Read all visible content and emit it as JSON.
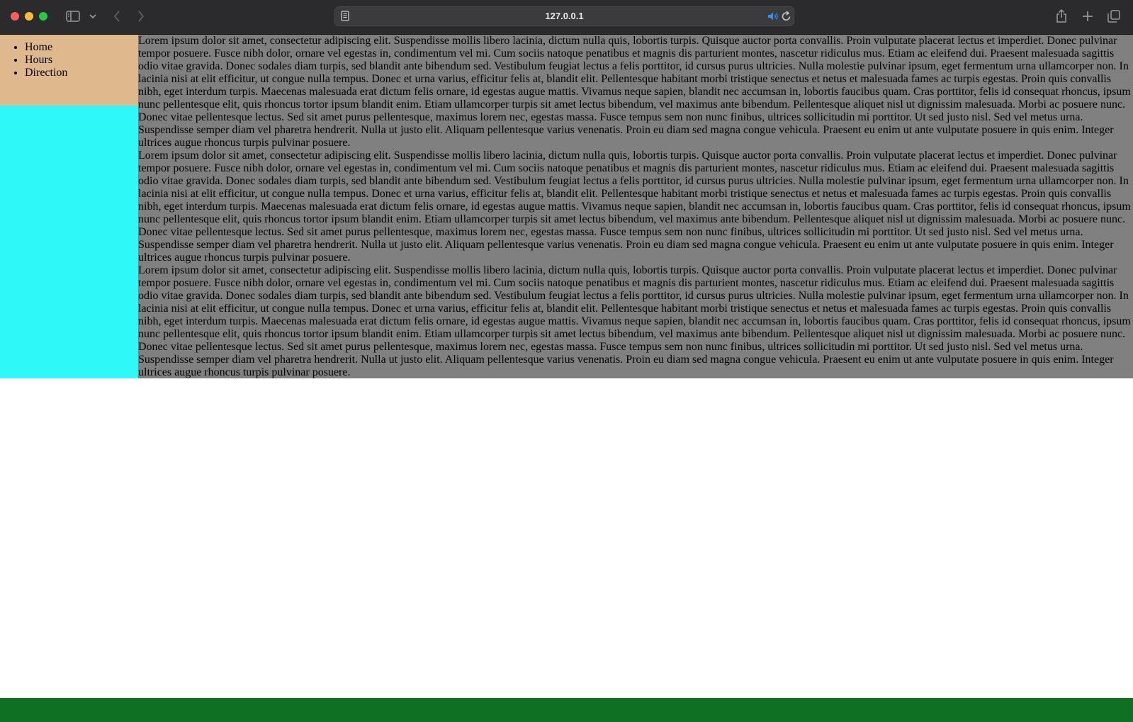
{
  "browser": {
    "url": "127.0.0.1",
    "icons": [
      "sidebar-icon",
      "chevron-down-icon",
      "back-icon",
      "forward-icon",
      "page-icon",
      "audio-icon",
      "reload-icon",
      "share-icon",
      "new-tab-icon",
      "tabs-overview-icon"
    ]
  },
  "nav": {
    "items": [
      "Home",
      "Hours",
      "Direction"
    ]
  },
  "main": {
    "paragraphs": [
      "Lorem ipsum dolor sit amet, consectetur adipiscing elit. Suspendisse mollis libero lacinia, dictum nulla quis, lobortis turpis. Quisque auctor porta convallis. Proin vulputate placerat lectus et imperdiet. Donec pulvinar tempor posuere. Fusce nibh dolor, ornare vel egestas in, condimentum vel mi. Cum sociis natoque penatibus et magnis dis parturient montes, nascetur ridiculus mus. Etiam ac eleifend dui. Praesent malesuada sagittis odio vitae gravida. Donec sodales diam turpis, sed blandit ante bibendum sed. Vestibulum feugiat lectus a felis porttitor, id cursus purus ultricies. Nulla molestie pulvinar ipsum, eget fermentum urna ullamcorper non. In lacinia nisi at elit efficitur, ut congue nulla tempus. Donec et urna varius, efficitur felis at, blandit elit. Pellentesque habitant morbi tristique senectus et netus et malesuada fames ac turpis egestas. Proin quis convallis nibh, eget interdum turpis. Maecenas malesuada erat dictum felis ornare, id egestas augue mattis. Vivamus neque sapien, blandit nec accumsan in, lobortis faucibus quam. Cras porttitor, felis id consequat rhoncus, ipsum nunc pellentesque elit, quis rhoncus tortor ipsum blandit enim. Etiam ullamcorper turpis sit amet lectus bibendum, vel maximus ante bibendum. Pellentesque aliquet nisl ut dignissim malesuada. Morbi ac posuere nunc. Donec vitae pellentesque lectus. Sed sit amet purus pellentesque, maximus lorem nec, egestas massa. Fusce tempus sem non nunc finibus, ultrices sollicitudin mi porttitor. Ut sed justo nisl. Sed vel metus urna. Suspendisse semper diam vel pharetra hendrerit. Nulla ut justo elit. Aliquam pellentesque varius venenatis. Proin eu diam sed magna congue vehicula. Praesent eu enim ut ante vulputate posuere in quis enim. Integer ultrices augue rhoncus turpis pulvinar posuere.",
      "Lorem ipsum dolor sit amet, consectetur adipiscing elit. Suspendisse mollis libero lacinia, dictum nulla quis, lobortis turpis. Quisque auctor porta convallis. Proin vulputate placerat lectus et imperdiet. Donec pulvinar tempor posuere. Fusce nibh dolor, ornare vel egestas in, condimentum vel mi. Cum sociis natoque penatibus et magnis dis parturient montes, nascetur ridiculus mus. Etiam ac eleifend dui. Praesent malesuada sagittis odio vitae gravida. Donec sodales diam turpis, sed blandit ante bibendum sed. Vestibulum feugiat lectus a felis porttitor, id cursus purus ultricies. Nulla molestie pulvinar ipsum, eget fermentum urna ullamcorper non. In lacinia nisi at elit efficitur, ut congue nulla tempus. Donec et urna varius, efficitur felis at, blandit elit. Pellentesque habitant morbi tristique senectus et netus et malesuada fames ac turpis egestas. Proin quis convallis nibh, eget interdum turpis. Maecenas malesuada erat dictum felis ornare, id egestas augue mattis. Vivamus neque sapien, blandit nec accumsan in, lobortis faucibus quam. Cras porttitor, felis id consequat rhoncus, ipsum nunc pellentesque elit, quis rhoncus tortor ipsum blandit enim. Etiam ullamcorper turpis sit amet lectus bibendum, vel maximus ante bibendum. Pellentesque aliquet nisl ut dignissim malesuada. Morbi ac posuere nunc. Donec vitae pellentesque lectus. Sed sit amet purus pellentesque, maximus lorem nec, egestas massa. Fusce tempus sem non nunc finibus, ultrices sollicitudin mi porttitor. Ut sed justo nisl. Sed vel metus urna. Suspendisse semper diam vel pharetra hendrerit. Nulla ut justo elit. Aliquam pellentesque varius venenatis. Proin eu diam sed magna congue vehicula. Praesent eu enim ut ante vulputate posuere in quis enim. Integer ultrices augue rhoncus turpis pulvinar posuere.",
      "Lorem ipsum dolor sit amet, consectetur adipiscing elit. Suspendisse mollis libero lacinia, dictum nulla quis, lobortis turpis. Quisque auctor porta convallis. Proin vulputate placerat lectus et imperdiet. Donec pulvinar tempor posuere. Fusce nibh dolor, ornare vel egestas in, condimentum vel mi. Cum sociis natoque penatibus et magnis dis parturient montes, nascetur ridiculus mus. Etiam ac eleifend dui. Praesent malesuada sagittis odio vitae gravida. Donec sodales diam turpis, sed blandit ante bibendum sed. Vestibulum feugiat lectus a felis porttitor, id cursus purus ultricies. Nulla molestie pulvinar ipsum, eget fermentum urna ullamcorper non. In lacinia nisi at elit efficitur, ut congue nulla tempus. Donec et urna varius, efficitur felis at, blandit elit. Pellentesque habitant morbi tristique senectus et netus et malesuada fames ac turpis egestas. Proin quis convallis nibh, eget interdum turpis. Maecenas malesuada erat dictum felis ornare, id egestas augue mattis. Vivamus neque sapien, blandit nec accumsan in, lobortis faucibus quam. Cras porttitor, felis id consequat rhoncus, ipsum nunc pellentesque elit, quis rhoncus tortor ipsum blandit enim. Etiam ullamcorper turpis sit amet lectus bibendum, vel maximus ante bibendum. Pellentesque aliquet nisl ut dignissim malesuada. Morbi ac posuere nunc. Donec vitae pellentesque lectus. Sed sit amet purus pellentesque, maximus lorem nec, egestas massa. Fusce tempus sem non nunc finibus, ultrices sollicitudin mi porttitor. Ut sed justo nisl. Sed vel metus urna. Suspendisse semper diam vel pharetra hendrerit. Nulla ut justo elit. Aliquam pellentesque varius venenatis. Proin eu diam sed magna congue vehicula. Praesent eu enim ut ante vulputate posuere in quis enim. Integer ultrices augue rhoncus turpis pulvinar posuere."
    ]
  },
  "colors": {
    "nav_bg": "#e0b88e",
    "sidebar_fill": "#2ef8f8",
    "main_bg": "#808080",
    "footer_bg": "#0f7023"
  }
}
